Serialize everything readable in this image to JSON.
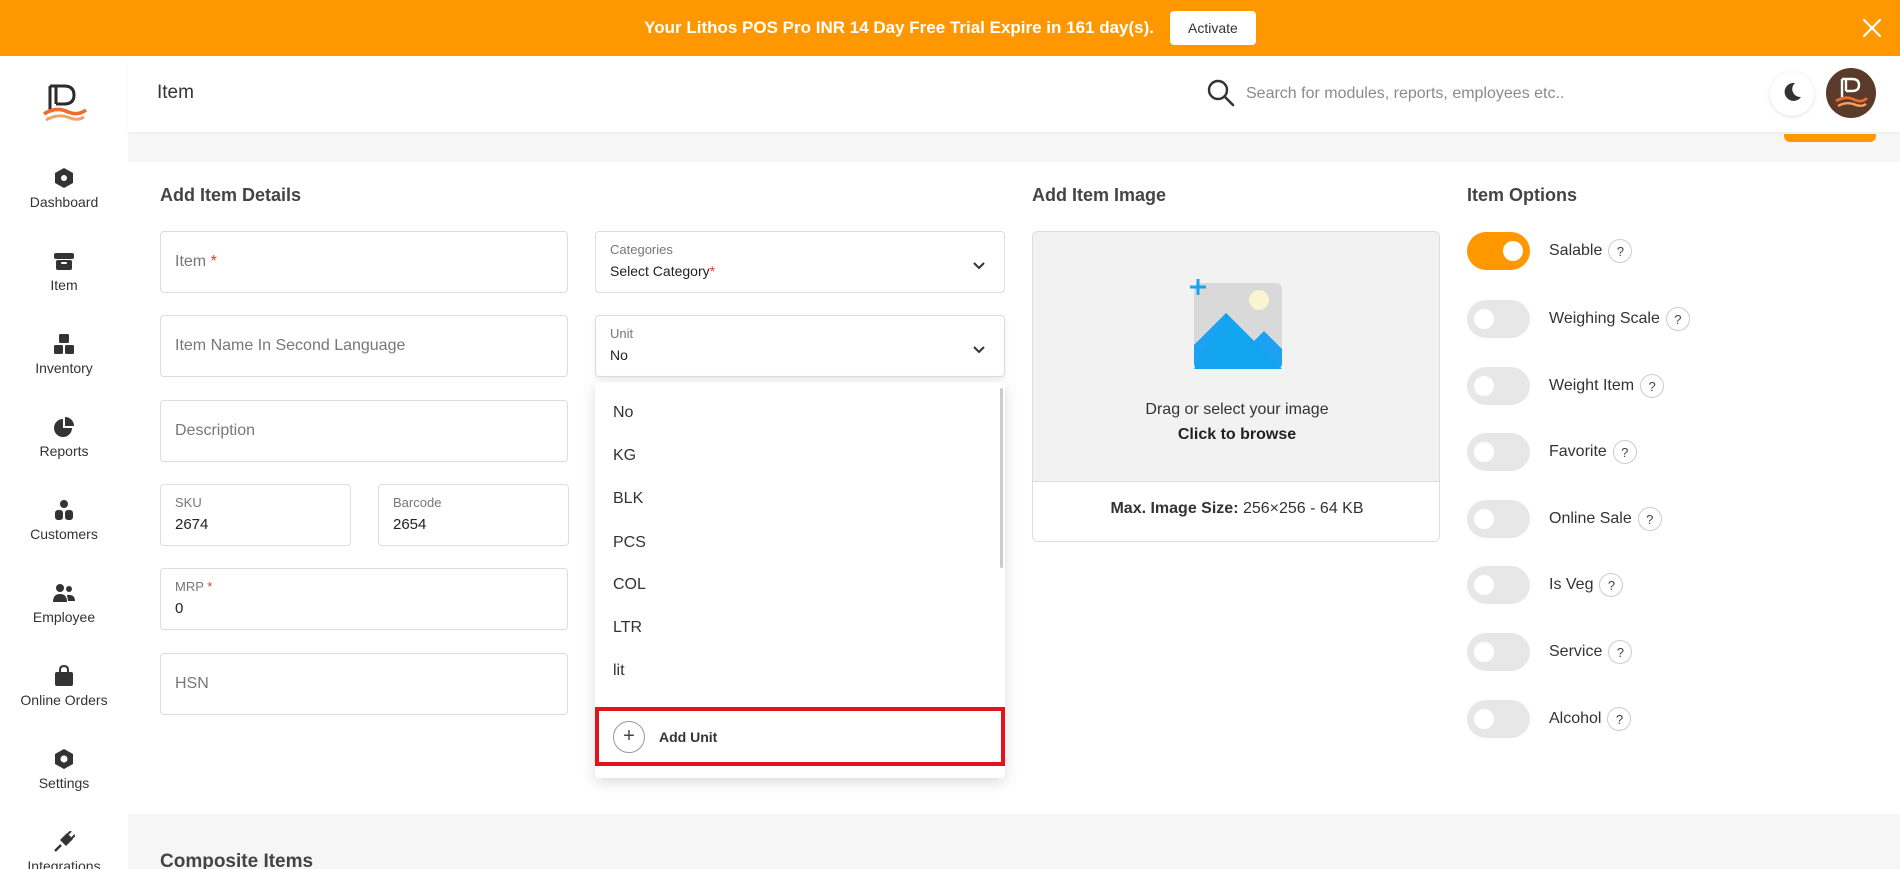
{
  "banner": {
    "message": "Your Lithos POS Pro INR 14 Day Free Trial Expire in 161 day(s).",
    "activate_label": "Activate",
    "bg_color": "#ff9800"
  },
  "sidebar": {
    "items": [
      {
        "label": "Dashboard",
        "icon": "dashboard-icon"
      },
      {
        "label": "Item",
        "icon": "item-box-icon"
      },
      {
        "label": "Inventory",
        "icon": "inventory-icon"
      },
      {
        "label": "Reports",
        "icon": "pie-chart-icon"
      },
      {
        "label": "Customers",
        "icon": "customers-icon"
      },
      {
        "label": "Employee",
        "icon": "employee-icon"
      },
      {
        "label": "Online Orders",
        "icon": "shopping-bag-icon"
      },
      {
        "label": "Settings",
        "icon": "settings-icon"
      },
      {
        "label": "Integrations",
        "icon": "plug-icon"
      }
    ]
  },
  "header": {
    "title": "Item",
    "search_placeholder": "Search for modules, reports, employees etc.."
  },
  "add_item": {
    "section_title": "Add Item Details",
    "item_placeholder": "Item",
    "required_mark": "*",
    "second_language_placeholder": "Item Name In Second Language",
    "description_placeholder": "Description",
    "sku": {
      "label": "SKU",
      "value": "2674"
    },
    "barcode": {
      "label": "Barcode",
      "value": "2654"
    },
    "mrp": {
      "label": "MRP",
      "value": "0"
    },
    "hsn_placeholder": "HSN",
    "categories": {
      "label": "Categories",
      "value": "Select Category"
    },
    "unit": {
      "label": "Unit",
      "value": "No"
    }
  },
  "unit_dropdown": {
    "options": [
      "No",
      "KG",
      "BLK",
      "PCS",
      "COL",
      "LTR",
      "lit"
    ],
    "add_unit_label": "Add Unit",
    "highlight_color": "#e0141e"
  },
  "image": {
    "section_title": "Add Item Image",
    "drag_text": "Drag or select your image",
    "browse_text": "Click to browse",
    "size_label": "Max. Image Size:",
    "size_value": "256×256 - 64 KB"
  },
  "options": {
    "section_title": "Item Options",
    "help_glyph": "?",
    "accent_color": "#ff9800",
    "items": [
      {
        "label": "Salable",
        "on": true
      },
      {
        "label": "Weighing Scale",
        "on": false
      },
      {
        "label": "Weight Item",
        "on": false
      },
      {
        "label": "Favorite",
        "on": false
      },
      {
        "label": "Online Sale",
        "on": false
      },
      {
        "label": "Is Veg",
        "on": false
      },
      {
        "label": "Service",
        "on": false
      },
      {
        "label": "Alcohol",
        "on": false
      }
    ]
  },
  "composite": {
    "title": "Composite Items"
  }
}
